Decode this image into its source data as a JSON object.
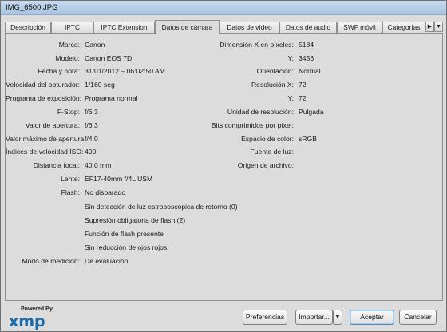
{
  "window": {
    "title": "IMG_6500.JPG"
  },
  "tabs": [
    "Descripción",
    "IPTC",
    "IPTC Extension",
    "Datos de cámara",
    "Datos de vídeo",
    "Datos de audio",
    "SWF móvil",
    "Categorías"
  ],
  "active_tab": "Datos de cámara",
  "tab_scroll": {
    "right": "▶",
    "menu": "▼"
  },
  "camera_left": [
    {
      "label": "Marca:",
      "value": "Canon"
    },
    {
      "label": "Modelo:",
      "value": "Canon EOS 7D"
    },
    {
      "label": "Fecha y hora:",
      "value": "31/01/2012 – 06:02:50 AM"
    },
    {
      "label": "Velocidad del obturador:",
      "value": "1/160 seg"
    },
    {
      "label": "Programa de exposición:",
      "value": "Programa normal"
    },
    {
      "label": "F-Stop:",
      "value": "f/6,3"
    },
    {
      "label": "Valor de apertura:",
      "value": "f/6,3"
    },
    {
      "label": "Valor máximo de apertura:",
      "value": "f/4,0"
    },
    {
      "label": "Índices de velocidad ISO:",
      "value": "400"
    },
    {
      "label": "Distancia focal:",
      "value": "40,0 mm"
    },
    {
      "label": "Lente:",
      "value": "EF17-40mm f/4L USM"
    },
    {
      "label": "Flash:",
      "value": "No disparado"
    },
    {
      "label": "",
      "value": "Sin detección de luz estroboscópica de retorno (0)"
    },
    {
      "label": "",
      "value": "Supresión obligatoria de flash (2)"
    },
    {
      "label": "",
      "value": "Función de flash presente"
    },
    {
      "label": "",
      "value": "Sin reducción de ojos rojos"
    },
    {
      "label": "Modo de medición:",
      "value": "De evaluación"
    }
  ],
  "camera_right": [
    {
      "label": "Dimensión X en píxeles:",
      "value": "5184"
    },
    {
      "label": "Y:",
      "value": "3456"
    },
    {
      "label": "Orientación:",
      "value": "Normal"
    },
    {
      "label": "Resolución X:",
      "value": "72"
    },
    {
      "label": "Y:",
      "value": "72"
    },
    {
      "label": "Unidad de resolución:",
      "value": "Pulgada"
    },
    {
      "label": "Bits comprimidos por píxel:",
      "value": ""
    },
    {
      "label": "Espacio de color:",
      "value": "sRGB"
    },
    {
      "label": "Fuente de luz:",
      "value": ""
    },
    {
      "label": "Origen de archivo:",
      "value": ""
    }
  ],
  "footer": {
    "logo_powered": "Powered By",
    "logo_xmp": "xmp",
    "preferences": "Preferencias",
    "import": "Importar...",
    "import_menu": "▼",
    "accept": "Aceptar",
    "cancel": "Cancelar"
  }
}
